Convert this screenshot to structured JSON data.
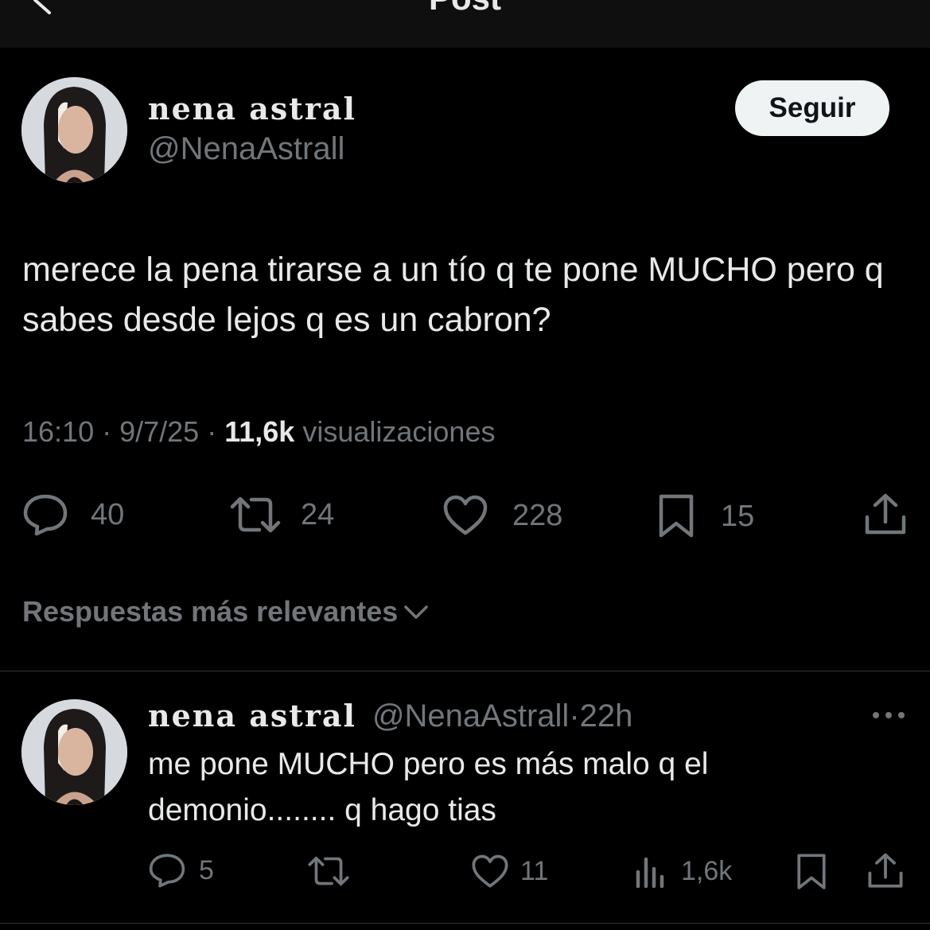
{
  "header": {
    "title": "Post"
  },
  "post": {
    "display_name": "nena astral",
    "handle": "@NenaAstrall",
    "follow_label": "Seguir",
    "text": "merece la pena tirarse a un tío q te pone MUCHO pero q sabes desde lejos q es un cabron?",
    "time": "16:10",
    "date": "9/7/25",
    "views": "11,6k",
    "views_label": "visualizaciones",
    "replies": "40",
    "reposts": "24",
    "likes": "228",
    "bookmarks": "15"
  },
  "sort": {
    "label": "Respuestas más relevantes"
  },
  "reply": {
    "display_name": "nena astral",
    "handle": "@NenaAstrall",
    "age": "22h",
    "text": "me pone MUCHO pero es más malo q el demonio........ q hago tias",
    "replies": "5",
    "likes": "11",
    "views": "1,6k"
  },
  "icons": {
    "back": "chevron-left-icon",
    "reply": "speech-bubble-icon",
    "repost": "repost-arrows-icon",
    "like": "heart-icon",
    "bookmark": "bookmark-icon",
    "share": "share-upload-icon",
    "views": "bar-chart-icon",
    "more": "more-dots-icon",
    "sort": "chevron-down-icon"
  },
  "colors": {
    "background": "#000000",
    "text": "#e7e9ea",
    "muted": "#71767b",
    "button": "#eff3f4"
  }
}
